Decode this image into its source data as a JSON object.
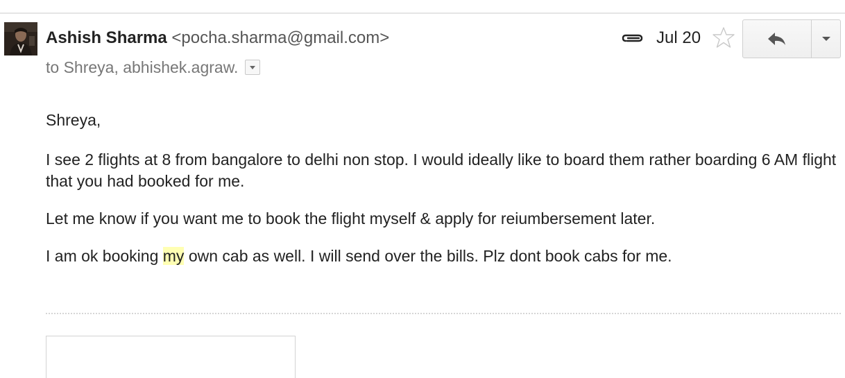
{
  "message": {
    "sender": {
      "name": "Ashish Sharma",
      "email": "<pocha.sharma@gmail.com>"
    },
    "recipients_text": "to Shreya, abhishek.agraw.",
    "date": "Jul 20",
    "icons": {
      "avatar": "avatar-photo",
      "attachment": "paperclip-icon",
      "star": "star-outline-icon",
      "reply": "reply-arrow-icon",
      "more": "dropdown-triangle-icon",
      "details": "details-dropdown-icon"
    },
    "body": {
      "greeting": "Shreya,",
      "para1": "I see 2 flights at 8 from bangalore to delhi non stop. I would ideally like to board them rather boarding 6 AM flight that you had booked for me.",
      "para2": "Let me know if you want me to book the flight myself & apply for reiumbersement later.",
      "para3_before": "I am ok booking ",
      "para3_highlight": "my",
      "para3_after": " own cab as well. I will send over the bills. Plz dont book cabs for me."
    }
  },
  "colors": {
    "highlight": "#ffffb3",
    "secondary_text": "#777777",
    "border": "#cfcfcf"
  }
}
